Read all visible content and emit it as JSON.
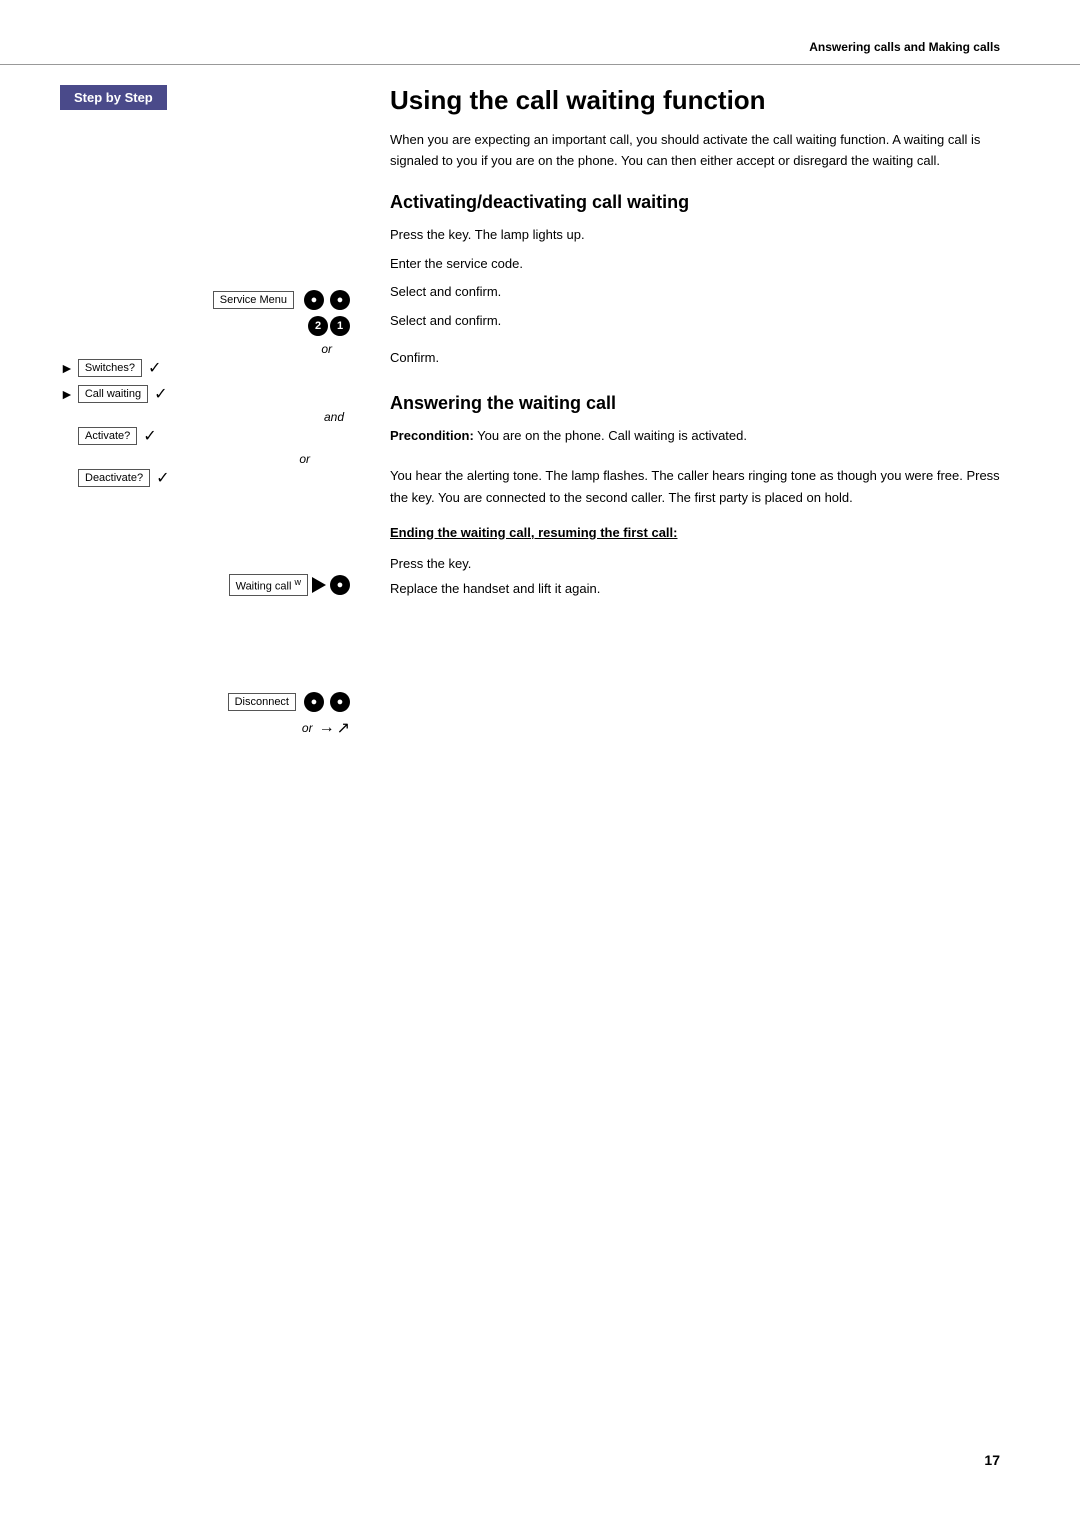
{
  "page": {
    "header": "Answering calls and Making calls",
    "page_number": "17"
  },
  "left_col": {
    "step_label": "Step by Step",
    "service_menu_key": "Service Menu",
    "code_badge_1": "2",
    "code_badge_2": "1",
    "switches_key": "Switches?",
    "call_waiting_key": "Call waiting",
    "activate_key": "Activate?",
    "deactivate_key": "Deactivate?",
    "waiting_call_key": "Waiting call",
    "disconnect_key": "Disconnect",
    "or_label": "or",
    "and_label": "and"
  },
  "content": {
    "main_title": "Using the call waiting function",
    "intro": "When you are expecting an important call, you should activate the call waiting function. A waiting call is signaled to you if you are on the phone. You can then either accept or disregard the waiting call.",
    "section1_title": "Activating/deactivating call waiting",
    "step1_instruction": "Press the key. The lamp lights up.",
    "step2_instruction": "Enter the service code.",
    "step3_instruction": "Select and confirm.",
    "step4_instruction": "Select and confirm.",
    "step5_instruction": "Confirm.",
    "section2_title": "Answering the waiting call",
    "precondition_label": "Precondition:",
    "precondition_text": "You are on the phone. Call waiting is activated.",
    "waiting_instruction": "You hear the alerting tone. The lamp flashes. The caller hears ringing tone as though you were free. Press the key. You are connected to the second caller. The first party is placed on hold.",
    "subsection_title": "Ending the waiting call, resuming the first call:",
    "disconnect_instruction": "Press the key.",
    "or_instruction": "Replace the handset and lift it again."
  }
}
